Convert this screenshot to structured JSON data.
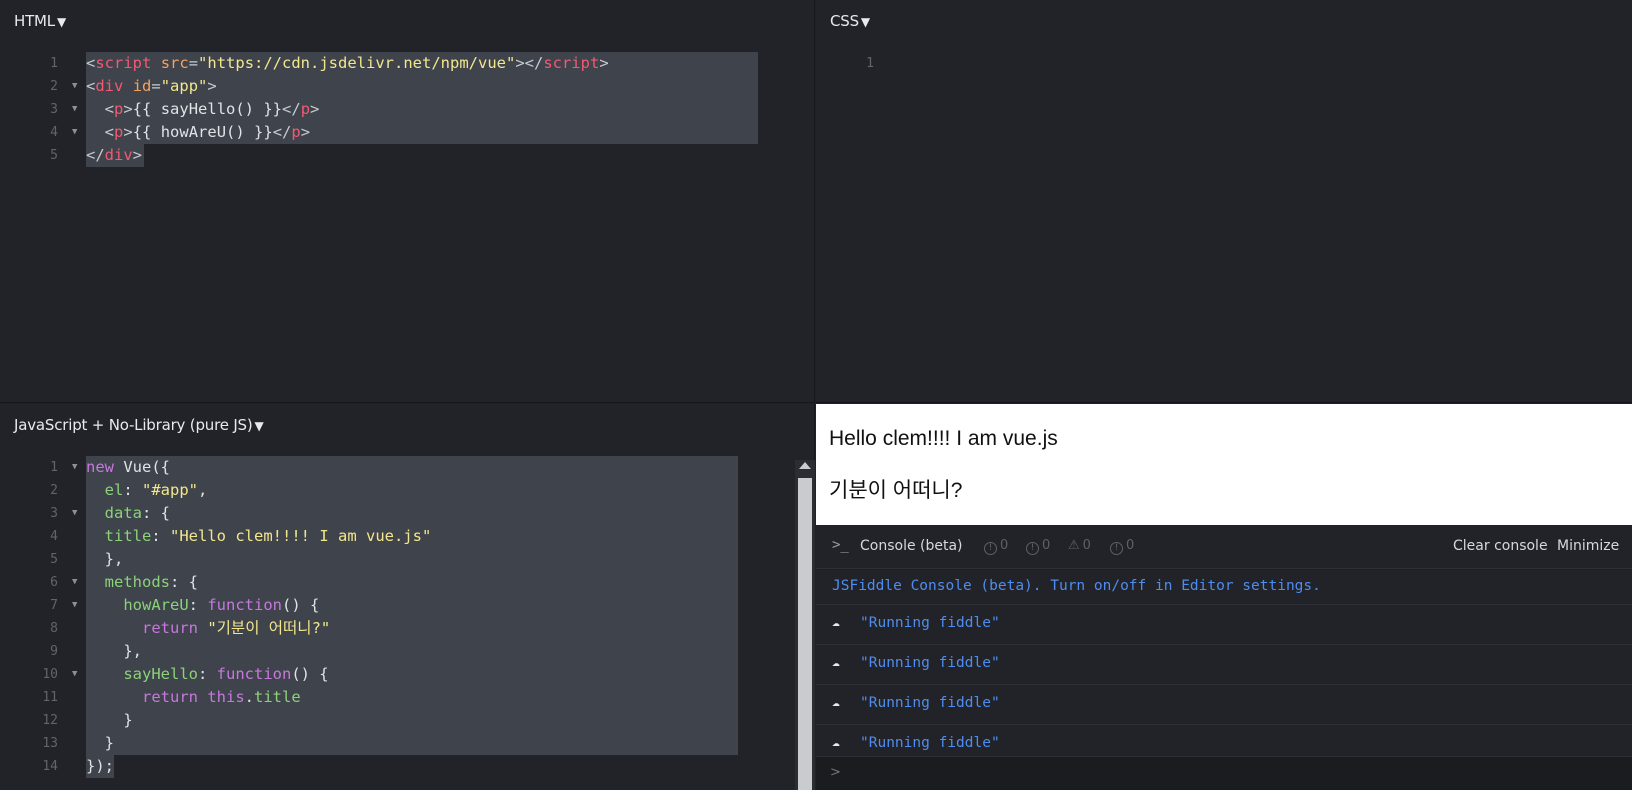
{
  "panes": {
    "html": {
      "title": "HTML"
    },
    "css": {
      "title": "CSS"
    },
    "js": {
      "title": "JavaScript + No-Library (pure JS)"
    }
  },
  "html_code": [
    {
      "n": "1",
      "fold": false,
      "sel": 672,
      "tokens": [
        [
          "t-punc",
          "<"
        ],
        [
          "t-tag",
          "script"
        ],
        [
          "t-plain",
          " "
        ],
        [
          "t-attr",
          "src"
        ],
        [
          "t-punc",
          "="
        ],
        [
          "t-str",
          "\"https://cdn.jsdelivr.net/npm/vue\""
        ],
        [
          "t-punc",
          "></"
        ],
        [
          "t-tag",
          "script"
        ],
        [
          "t-punc",
          ">"
        ]
      ]
    },
    {
      "n": "2",
      "fold": true,
      "sel": 672,
      "tokens": [
        [
          "t-punc",
          "<"
        ],
        [
          "t-tag",
          "div"
        ],
        [
          "t-plain",
          " "
        ],
        [
          "t-attr",
          "id"
        ],
        [
          "t-punc",
          "="
        ],
        [
          "t-str",
          "\"app\""
        ],
        [
          "t-punc",
          ">"
        ]
      ]
    },
    {
      "n": "3",
      "fold": true,
      "sel": 672,
      "tokens": [
        [
          "t-plain",
          "  "
        ],
        [
          "t-punc",
          "<"
        ],
        [
          "t-tag",
          "p"
        ],
        [
          "t-punc",
          ">"
        ],
        [
          "t-plain",
          "{{ sayHello() }}"
        ],
        [
          "t-punc",
          "</"
        ],
        [
          "t-tag",
          "p"
        ],
        [
          "t-punc",
          ">"
        ]
      ]
    },
    {
      "n": "4",
      "fold": true,
      "sel": 672,
      "tokens": [
        [
          "t-plain",
          "  "
        ],
        [
          "t-punc",
          "<"
        ],
        [
          "t-tag",
          "p"
        ],
        [
          "t-punc",
          ">"
        ],
        [
          "t-plain",
          "{{ howAreU() }}"
        ],
        [
          "t-punc",
          "</"
        ],
        [
          "t-tag",
          "p"
        ],
        [
          "t-punc",
          ">"
        ]
      ]
    },
    {
      "n": "5",
      "fold": false,
      "sel": 58,
      "tokens": [
        [
          "t-punc",
          "</"
        ],
        [
          "t-tag",
          "div"
        ],
        [
          "t-punc",
          ">"
        ]
      ]
    }
  ],
  "css_code": [
    {
      "n": "1",
      "fold": false,
      "sel": 0,
      "tokens": []
    }
  ],
  "js_code": [
    {
      "n": "1",
      "fold": true,
      "sel": 652,
      "tokens": [
        [
          "t-kw",
          "new"
        ],
        [
          "t-plain",
          " Vue({"
        ]
      ]
    },
    {
      "n": "2",
      "fold": false,
      "sel": 652,
      "tokens": [
        [
          "t-plain",
          "  "
        ],
        [
          "t-prop",
          "el"
        ],
        [
          "t-plain",
          ": "
        ],
        [
          "t-str",
          "\"#app\""
        ],
        [
          "t-plain",
          ","
        ]
      ]
    },
    {
      "n": "3",
      "fold": true,
      "sel": 652,
      "tokens": [
        [
          "t-plain",
          "  "
        ],
        [
          "t-prop",
          "data"
        ],
        [
          "t-plain",
          ": {"
        ]
      ]
    },
    {
      "n": "4",
      "fold": false,
      "sel": 652,
      "tokens": [
        [
          "t-plain",
          "  "
        ],
        [
          "t-prop",
          "title"
        ],
        [
          "t-plain",
          ": "
        ],
        [
          "t-str",
          "\"Hello clem!!!! I am vue.js\""
        ]
      ]
    },
    {
      "n": "5",
      "fold": false,
      "sel": 652,
      "tokens": [
        [
          "t-plain",
          "  },"
        ]
      ]
    },
    {
      "n": "6",
      "fold": true,
      "sel": 652,
      "tokens": [
        [
          "t-plain",
          "  "
        ],
        [
          "t-prop",
          "methods"
        ],
        [
          "t-plain",
          ": {"
        ]
      ]
    },
    {
      "n": "7",
      "fold": true,
      "sel": 652,
      "tokens": [
        [
          "t-plain",
          "    "
        ],
        [
          "t-prop",
          "howAreU"
        ],
        [
          "t-plain",
          ": "
        ],
        [
          "t-kw",
          "function"
        ],
        [
          "t-plain",
          "() {"
        ]
      ]
    },
    {
      "n": "8",
      "fold": false,
      "sel": 652,
      "tokens": [
        [
          "t-plain",
          "      "
        ],
        [
          "t-kw",
          "return"
        ],
        [
          "t-plain",
          " "
        ],
        [
          "t-str",
          "\"기분이 어떠니?\""
        ]
      ]
    },
    {
      "n": "9",
      "fold": false,
      "sel": 652,
      "tokens": [
        [
          "t-plain",
          "    },"
        ]
      ]
    },
    {
      "n": "10",
      "fold": true,
      "sel": 652,
      "tokens": [
        [
          "t-plain",
          "    "
        ],
        [
          "t-prop",
          "sayHello"
        ],
        [
          "t-plain",
          ": "
        ],
        [
          "t-kw",
          "function"
        ],
        [
          "t-plain",
          "() {"
        ]
      ]
    },
    {
      "n": "11",
      "fold": false,
      "sel": 652,
      "tokens": [
        [
          "t-plain",
          "      "
        ],
        [
          "t-kw",
          "return"
        ],
        [
          "t-plain",
          " "
        ],
        [
          "t-kw",
          "this"
        ],
        [
          "t-plain",
          "."
        ],
        [
          "t-prop",
          "title"
        ]
      ]
    },
    {
      "n": "12",
      "fold": false,
      "sel": 652,
      "tokens": [
        [
          "t-plain",
          "    }"
        ]
      ]
    },
    {
      "n": "13",
      "fold": false,
      "sel": 652,
      "tokens": [
        [
          "t-plain",
          "  }"
        ]
      ]
    },
    {
      "n": "14",
      "fold": false,
      "sel": 28,
      "tokens": [
        [
          "t-plain",
          "});"
        ]
      ]
    }
  ],
  "result": {
    "line1": "Hello clem!!!! I am vue.js",
    "line2": "기분이 어떠니?"
  },
  "console": {
    "title": "Console (beta)",
    "counts": [
      "0",
      "0",
      "0",
      "0"
    ],
    "clear_label": "Clear console",
    "minimize_label": "Minimize",
    "info": "JSFiddle Console (beta). Turn on/off in Editor settings.",
    "messages": [
      "\"Running fiddle\"",
      "\"Running fiddle\"",
      "\"Running fiddle\"",
      "\"Running fiddle\""
    ],
    "input_prompt": ">"
  },
  "colors": {
    "tag": "#f25a72",
    "attr": "#f4a261",
    "string": "#f2e78d",
    "keyword": "#c678dd",
    "property": "#8bd27a",
    "console_text": "#4f8cf0"
  }
}
